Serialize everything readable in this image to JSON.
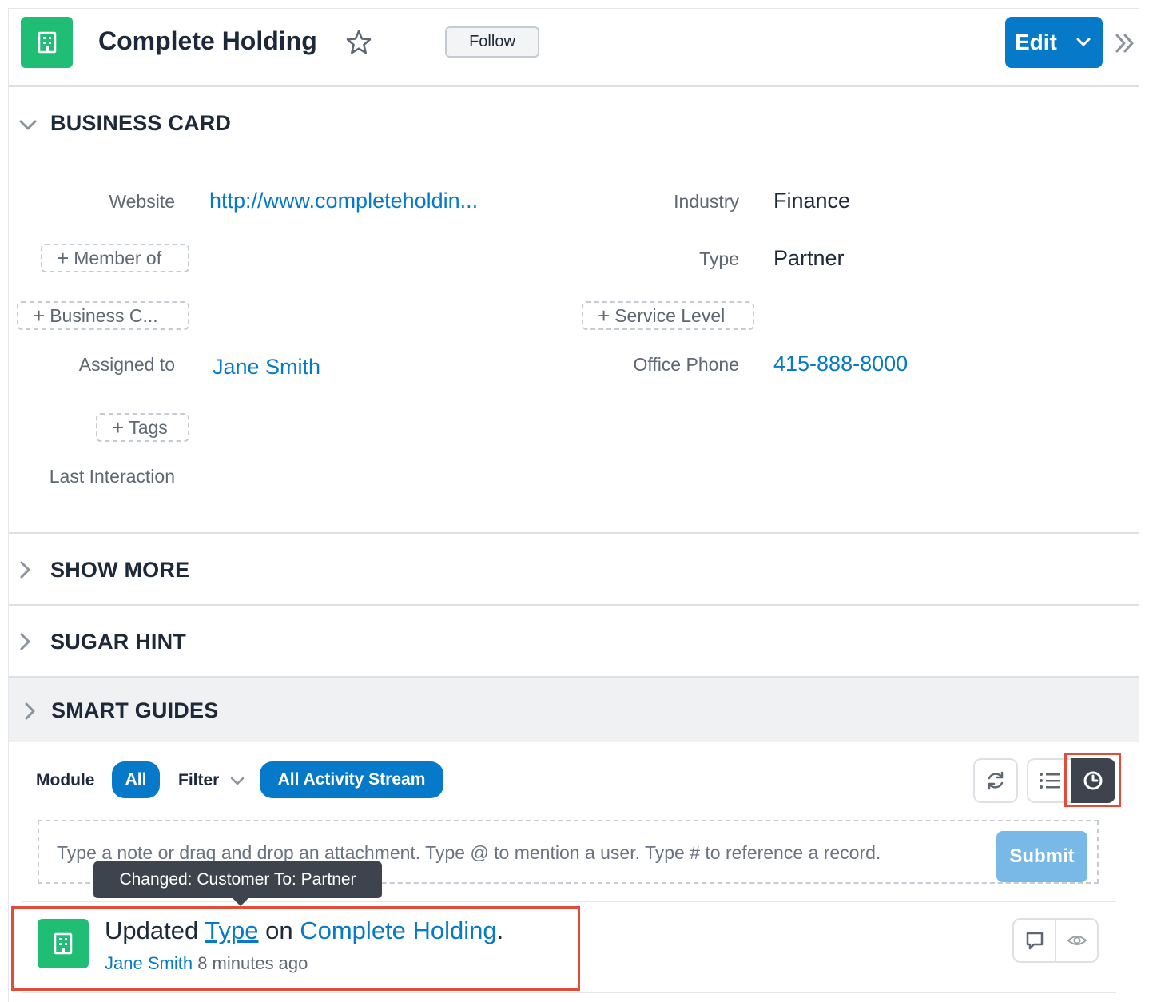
{
  "header": {
    "title": "Complete Holding",
    "follow_label": "Follow",
    "edit_label": "Edit"
  },
  "business_card": {
    "section_label": "BUSINESS CARD",
    "website_label": "Website",
    "website_value": "http://www.completeholdin...",
    "member_of_label": "Member of",
    "business_center_label": "Business C...",
    "assigned_to_label": "Assigned to",
    "assigned_to_value": "Jane Smith",
    "tags_label": "Tags",
    "last_interaction_label": "Last Interaction",
    "industry_label": "Industry",
    "industry_value": "Finance",
    "type_label": "Type",
    "type_value": "Partner",
    "service_level_label": "Service Level",
    "office_phone_label": "Office Phone",
    "office_phone_value": "415-888-8000"
  },
  "sections": {
    "show_more": "SHOW MORE",
    "sugar_hint": "SUGAR HINT",
    "smart_guides": "SMART GUIDES"
  },
  "activity": {
    "module_label": "Module",
    "module_value": "All",
    "filter_label": "Filter",
    "filter_value": "All Activity Stream",
    "note_placeholder": "Type a note or drag and drop an attachment. Type @ to mention a user. Type # to reference a record.",
    "submit_label": "Submit",
    "tooltip": "Changed: Customer To: Partner",
    "entry": {
      "action": "Updated",
      "field_link": "Type",
      "on_text": "on",
      "record_link": "Complete Holding",
      "period": ".",
      "user": "Jane Smith",
      "time": "8 minutes ago"
    }
  },
  "colors": {
    "accent": "#0679c8",
    "record_icon": "#1fbe74",
    "highlight": "#e24c3a"
  },
  "icons": {
    "record": "building-icon",
    "star": "star-icon",
    "refresh": "refresh-icon",
    "list": "list-icon",
    "clock": "clock-icon",
    "comment": "comment-icon",
    "eye": "eye-icon"
  }
}
